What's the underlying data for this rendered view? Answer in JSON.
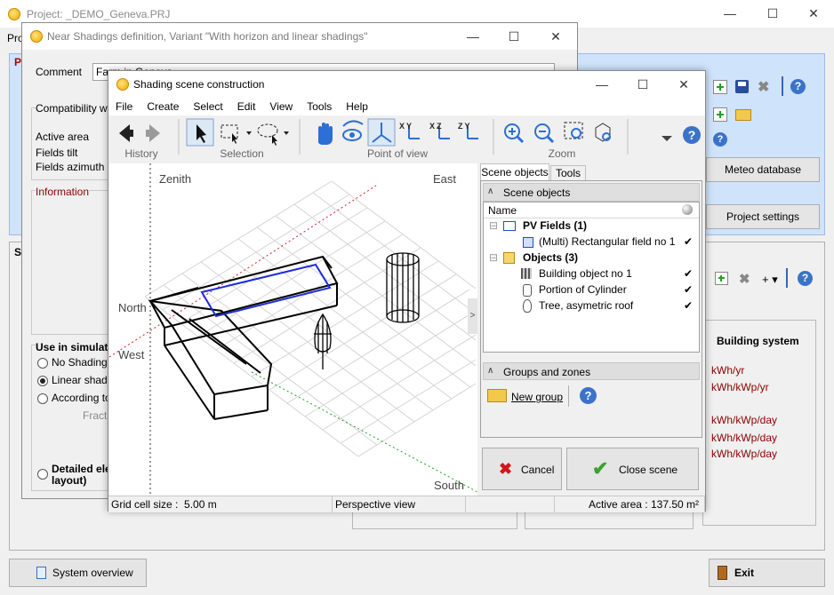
{
  "main_window": {
    "title": "Project: _DEMO_Geneva.PRJ",
    "menu_partial": "Pro",
    "right_panel": {
      "meteo_button": "Meteo database",
      "project_settings_button": "Project settings",
      "building_system_header": "Building system",
      "units": [
        "kWh/yr",
        "kWh/kWp/yr",
        "kWh/kWp/day",
        "kWh/kWp/day",
        "kWh/kWp/day"
      ]
    },
    "bottom": {
      "system_overview_button": "System overview",
      "exit_button": "Exit"
    }
  },
  "near_window": {
    "title": "Near Shadings definition, Variant \"With horizon and linear shadings\"",
    "comment_label": "Comment",
    "comment_value": "Farm in Geneva",
    "compat_label": "Compatibility with",
    "active_area_label": "Active area",
    "fields_tilt_label": "Fields tilt",
    "fields_azimuth_label": "Fields azimuth",
    "information_label": "Information",
    "use_in_sim_label": "Use in simulati",
    "radio_no_shadings": "No Shadings",
    "radio_linear": "Linear shadin",
    "radio_according": "According to",
    "fraction_label": "Fracti",
    "detailed_label_1": "Detailed ele",
    "detailed_label_2": "layout)"
  },
  "scene_window": {
    "title": "Shading scene construction",
    "menu": [
      "File",
      "Create",
      "Select",
      "Edit",
      "View",
      "Tools",
      "Help"
    ],
    "toolbar_groups": {
      "history": "History",
      "selection": "Selection",
      "point_of_view": "Point of view",
      "zoom": "Zoom"
    },
    "axis_icons": [
      "XY",
      "XZ",
      "ZY"
    ],
    "view_labels": {
      "zenith": "Zenith",
      "east": "East",
      "north": "North",
      "west": "West",
      "south": "South"
    },
    "collapse_arrow": ">",
    "tabs": [
      "Scene objects",
      "Tools"
    ],
    "scene_objects_section": "Scene objects",
    "name_column": "Name",
    "tree": {
      "pv_fields": "PV Fields (1)",
      "pv_item": "(Multi) Rectangular field no 1",
      "objects": "Objects (3)",
      "obj_items": [
        "Building object no 1",
        "Portion of Cylinder",
        "Tree, asymetric roof"
      ]
    },
    "groups_section": "Groups and zones",
    "new_group_button": "New group",
    "cancel_button": "Cancel",
    "close_scene_button": "Close scene",
    "status": {
      "grid_cell_label": "Grid cell size :",
      "grid_cell_value": "5.00 m",
      "view_mode": "Perspective view",
      "active_area": "Active area : 137.50 m²"
    },
    "check_mark": "✔"
  }
}
